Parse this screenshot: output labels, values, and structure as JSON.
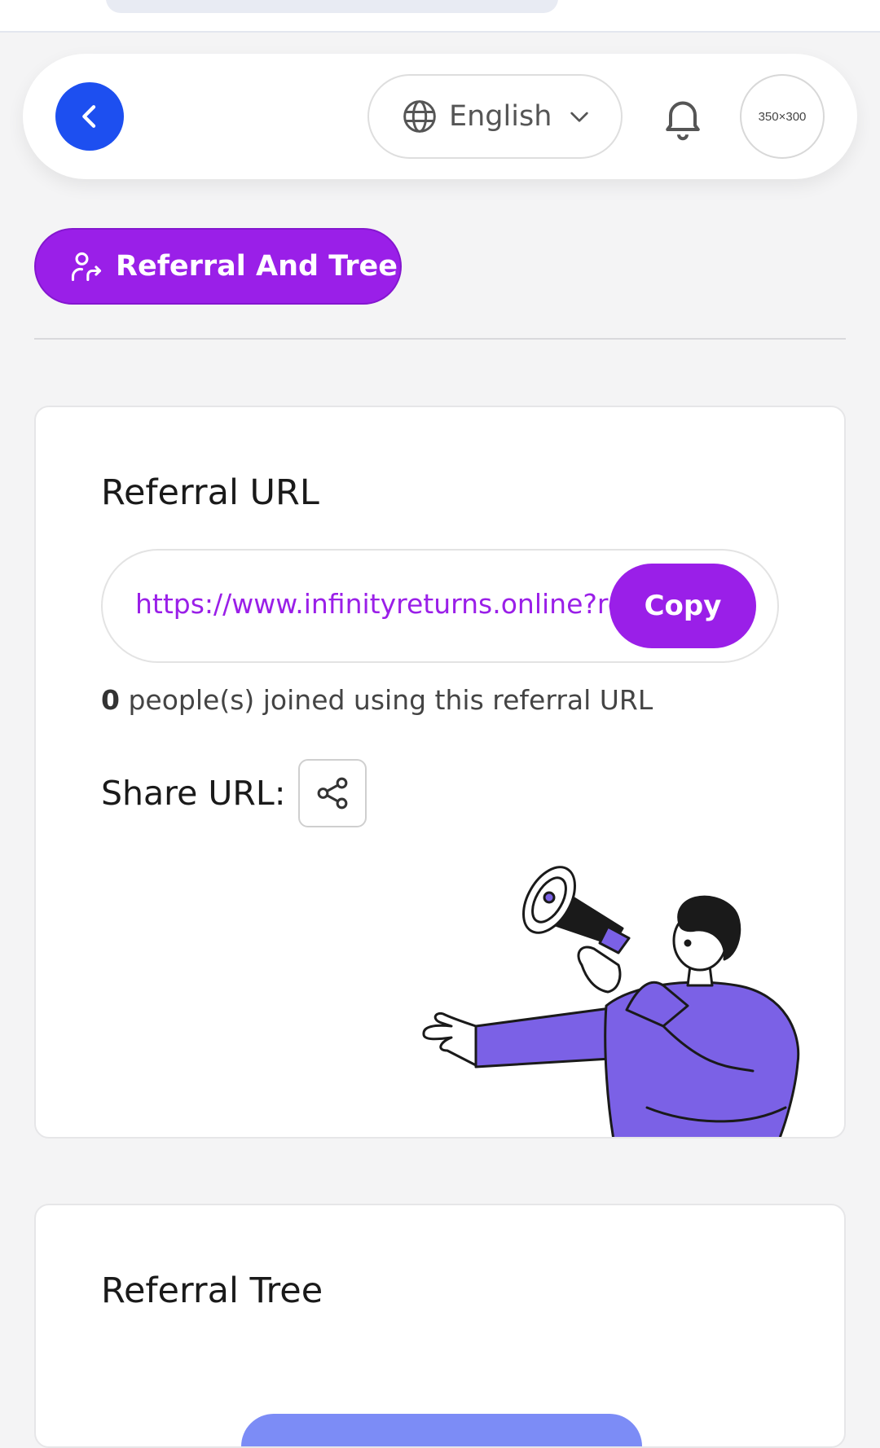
{
  "header": {
    "back_icon": "chevron-left-icon",
    "language": {
      "icon": "globe-icon",
      "selected": "English",
      "dropdown_icon": "chevron-down-icon"
    },
    "notification_icon": "bell-icon",
    "avatar_placeholder": "350×300"
  },
  "section_tab": {
    "icon": "user-share-icon",
    "label": "Referral And Tree"
  },
  "referral_card": {
    "title": "Referral URL",
    "url": "https://www.infinityreturns.online?ref=",
    "copy_label": "Copy",
    "joined_count": "0",
    "joined_text": " people(s) joined using this referral URL",
    "share_label": "Share URL:",
    "share_icon": "share-icon",
    "illustration": "person-with-megaphone-illustration"
  },
  "tree_card": {
    "title": "Referral Tree"
  },
  "colors": {
    "primary_purple": "#9a1fe8",
    "back_blue": "#1d4ff0",
    "illustration_purple": "#7b61e6",
    "tree_button": "#7c8cf6"
  }
}
